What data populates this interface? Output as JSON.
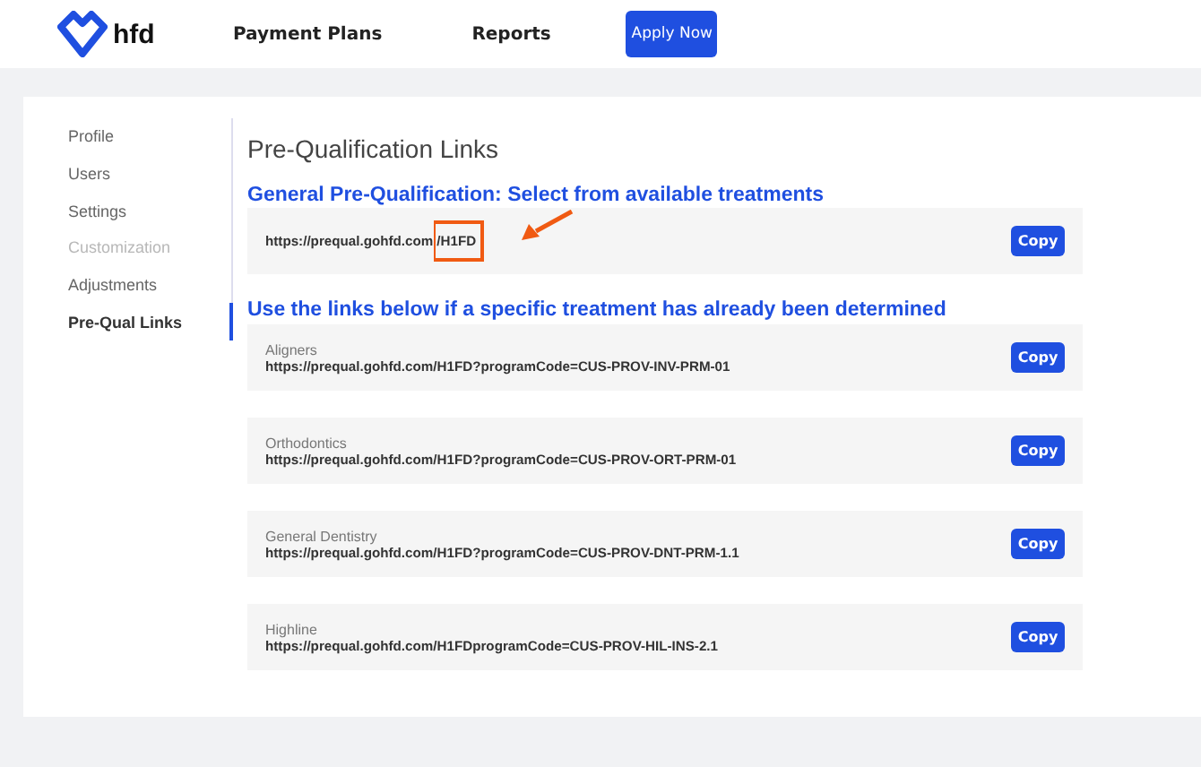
{
  "header": {
    "logo_text": "hfd",
    "nav": [
      {
        "label": "Payment Plans"
      },
      {
        "label": "Reports"
      }
    ],
    "cta": "Apply Now"
  },
  "sidebar": {
    "items": [
      {
        "label": "Profile",
        "selected": false,
        "disabled": false
      },
      {
        "label": "Users",
        "selected": false,
        "disabled": false
      },
      {
        "label": "Settings",
        "selected": false,
        "disabled": false
      },
      {
        "label": "Customization",
        "selected": false,
        "disabled": true
      },
      {
        "label": "Adjustments",
        "selected": false,
        "disabled": false
      },
      {
        "label": "Pre-Qual Links",
        "selected": true,
        "disabled": false
      }
    ]
  },
  "main": {
    "title": "Pre-Qualification Links",
    "general_heading": "General Pre-Qualification: Select from available treatments",
    "general_link": {
      "url": "https://prequal.gohfd.com/H1FD",
      "button": "Copy",
      "highlighted": true
    },
    "specific_heading": "Use the links below if a specific treatment has already been determined",
    "links": [
      {
        "name": "Aligners",
        "url": "https://prequal.gohfd.com/H1FD?programCode=CUS-PROV-INV-PRM-01",
        "button": "Copy"
      },
      {
        "name": "Orthodontics",
        "url": "https://prequal.gohfd.com/H1FD?programCode=CUS-PROV-ORT-PRM-01",
        "button": "Copy"
      },
      {
        "name": "General Dentistry",
        "url": "https://prequal.gohfd.com/H1FD?programCode=CUS-PROV-DNT-PRM-1.1",
        "button": "Copy"
      },
      {
        "name": "Highline",
        "url": "https://prequal.gohfd.com/H1FDprogramCode=CUS-PROV-HIL-INS-2.1",
        "button": "Copy"
      }
    ]
  }
}
